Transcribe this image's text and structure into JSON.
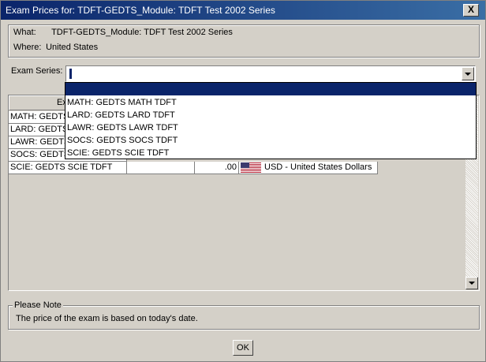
{
  "window": {
    "title": "Exam Prices for: TDFT-GEDTS_Module: TDFT Test 2002 Series",
    "close_label": "X"
  },
  "info": {
    "what_label": "What:",
    "what_value": "TDFT-GEDTS_Module: TDFT Test 2002 Series",
    "where_label": "Where:",
    "where_value": "United States"
  },
  "exam_series": {
    "label": "Exam Series:",
    "value": ""
  },
  "dropdown": {
    "items": [
      {
        "label": ""
      },
      {
        "label": "MATH: GEDTS MATH TDFT"
      },
      {
        "label": "LARD: GEDTS LARD TDFT"
      },
      {
        "label": "LAWR: GEDTS LAWR TDFT"
      },
      {
        "label": "SOCS: GEDTS SOCS TDFT"
      },
      {
        "label": "SCIE: GEDTS SCIE TDFT"
      }
    ]
  },
  "grid": {
    "header_first": "Exam",
    "rows": [
      {
        "exam": "MATH: GEDTS"
      },
      {
        "exam": "LARD: GEDTS"
      },
      {
        "exam": "LAWR: GEDTS"
      },
      {
        "exam": "SOCS: GEDTS"
      },
      {
        "exam": "SCIE: GEDTS SCIE TDFT",
        "price": ".00",
        "currency": "USD - United States Dollars"
      }
    ]
  },
  "note": {
    "legend": "Please Note",
    "text": "The price of the exam is based on today's date."
  },
  "ok_label": "OK",
  "colors": {
    "title_bar": "#0a246a",
    "selection": "#0a246a",
    "dialog_bg": "#d4d0c8"
  }
}
